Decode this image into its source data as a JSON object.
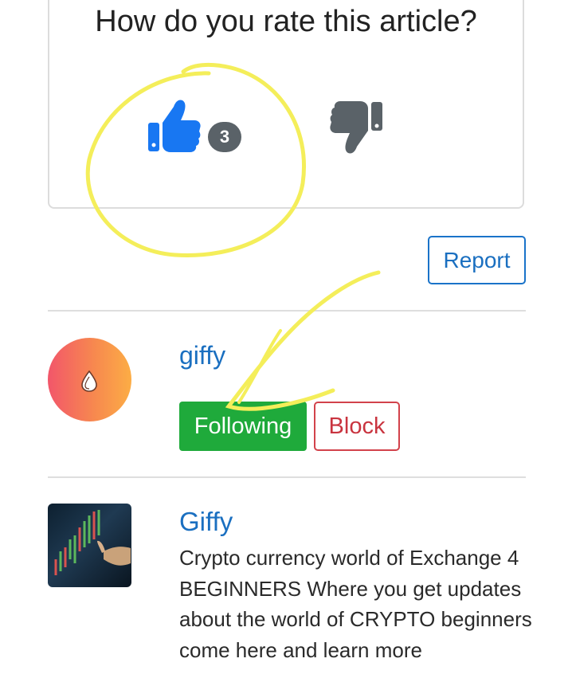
{
  "rating": {
    "question": "How do you rate this article?",
    "like_count": "3"
  },
  "report": {
    "label": "Report"
  },
  "author": {
    "name": "giffy",
    "following_label": "Following",
    "block_label": "Block"
  },
  "community": {
    "name": "Giffy",
    "description": "Crypto currency world of Exchange 4 BEGINNERS Where you get updates about the world of CRYPTO beginners come here and learn more"
  },
  "colors": {
    "link_blue": "#1a6fc0",
    "like_blue": "#1877f2",
    "following_green": "#1faa3b",
    "block_red": "#c9343f",
    "annotation_yellow": "#f4ee5a"
  },
  "icons": {
    "like": "thumbs-up-icon",
    "dislike": "thumbs-down-icon",
    "avatar": "drop-icon"
  }
}
